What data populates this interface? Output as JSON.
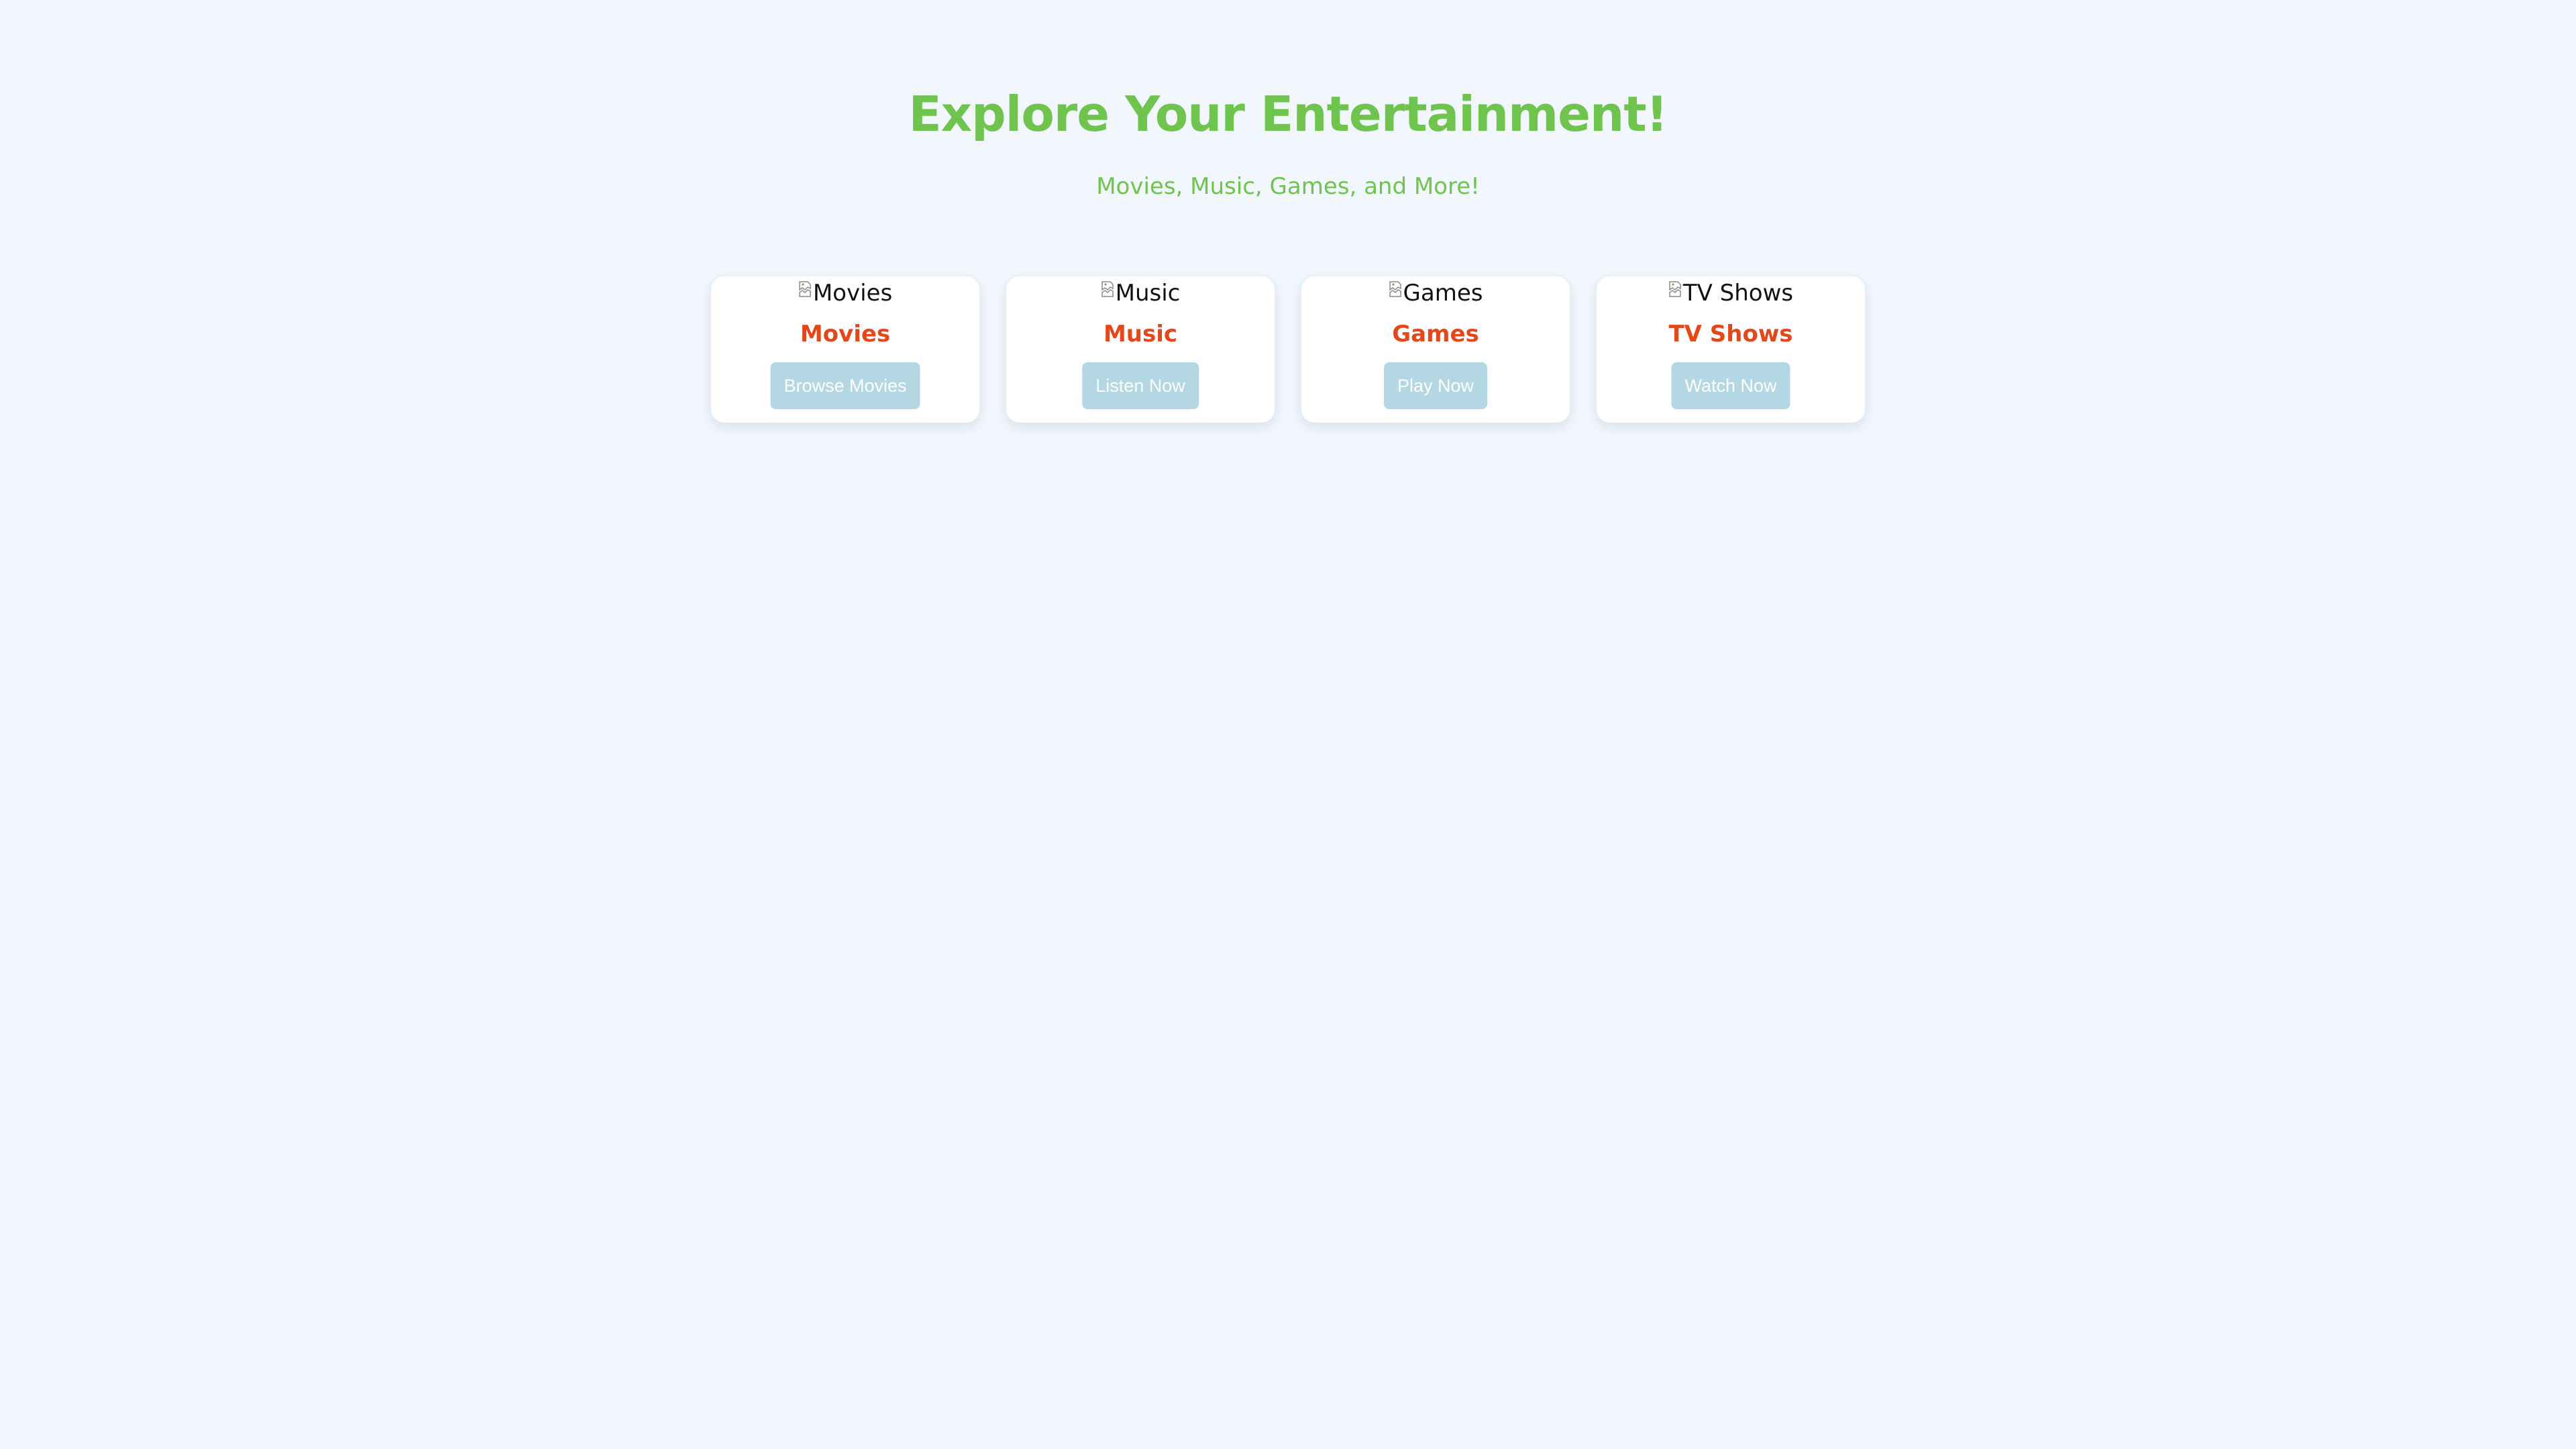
{
  "header": {
    "title": "Explore Your Entertainment!",
    "subtitle": "Movies, Music, Games, and More!"
  },
  "cards": [
    {
      "image_alt": "Movies",
      "title": "Movies",
      "button_label": "Browse Movies"
    },
    {
      "image_alt": "Music",
      "title": "Music",
      "button_label": "Listen Now"
    },
    {
      "image_alt": "Games",
      "title": "Games",
      "button_label": "Play Now"
    },
    {
      "image_alt": "TV Shows",
      "title": "TV Shows",
      "button_label": "Watch Now"
    }
  ],
  "colors": {
    "background": "#f1f7fd",
    "title_green": "#6ec44c",
    "card_title_orange": "#e4471a",
    "button_blue": "#b3d7e3"
  },
  "icons": {
    "card_image": "broken-image-icon"
  }
}
